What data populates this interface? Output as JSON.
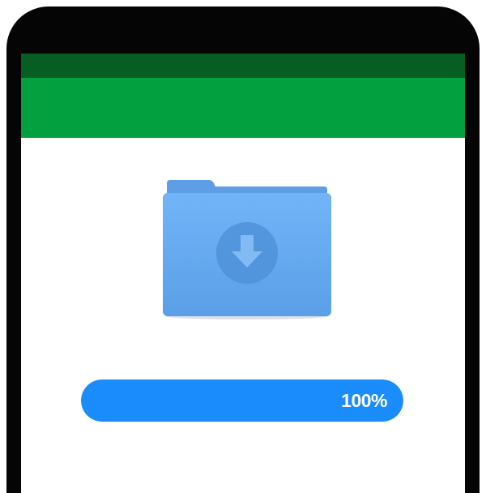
{
  "colors": {
    "status_bar": "#075e22",
    "app_bar": "#02a03e",
    "progress": "#1a8cfb",
    "folder": "#68aef5"
  },
  "download": {
    "icon": "folder-download-icon",
    "progress_fraction": 1.0,
    "progress_label": "100%"
  }
}
